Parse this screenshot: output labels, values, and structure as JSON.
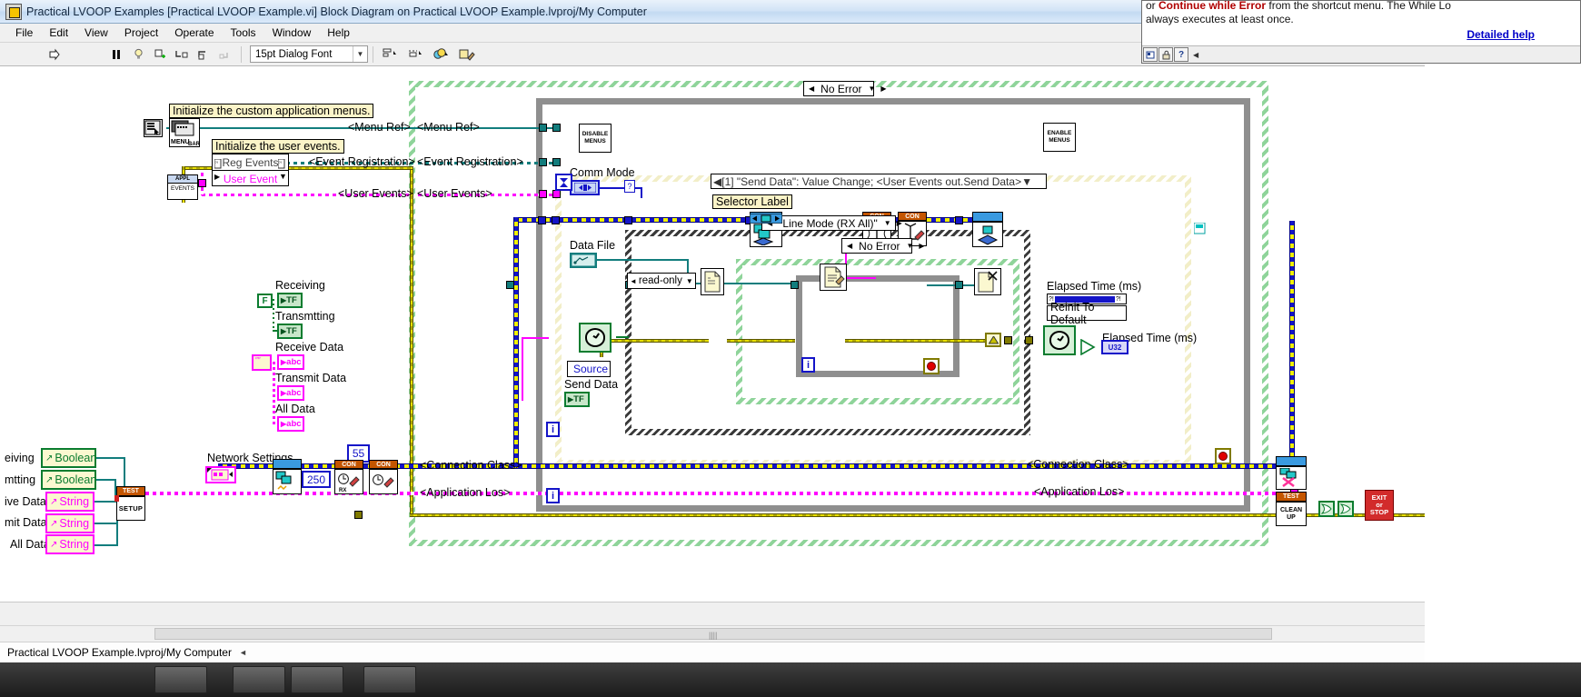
{
  "window": {
    "title": "Practical LVOOP  Examples [Practical LVOOP Example.vi] Block Diagram on Practical LVOOP Example.lvproj/My Computer",
    "app_icon": "labview-icon"
  },
  "menubar": {
    "items": [
      "File",
      "Edit",
      "View",
      "Project",
      "Operate",
      "Tools",
      "Window",
      "Help"
    ]
  },
  "toolbar": {
    "run_arrow": "run-arrow-icon",
    "pause": "pause-icon",
    "highlight": "highlight-execution-icon",
    "retain_values": "retain-wire-values-icon",
    "step_into": "step-into-icon",
    "step_over": "step-over-icon",
    "step_out": "step-out-icon",
    "font_value": "15pt Dialog Font",
    "align_objects": "align-objects-icon",
    "distribute_objects": "distribute-objects-icon",
    "reorder": "reorder-icon",
    "clean_up": "clean-up-diagram-icon"
  },
  "help_window": {
    "line1_pre": "or ",
    "line1_bold": "Continue while Error",
    "line1_post": " from the shortcut menu. The While Lo",
    "line2": "always executes at least once.",
    "detailed_help": "Detailed help",
    "buttons": [
      "show-context-help-icon",
      "lock-help-icon",
      "detailed-help-icon",
      "back-arrow-icon"
    ]
  },
  "statusbar": {
    "project": "Practical LVOOP Example.lvproj/My Computer",
    "arrow": "◄"
  },
  "diagram": {
    "comments": [
      {
        "id": "init-menus",
        "text": "Initialize the custom application menus."
      },
      {
        "id": "init-events",
        "text": "Initialize the user events."
      }
    ],
    "free_labels": [
      {
        "id": "selector-label",
        "text": "Selector Label"
      }
    ],
    "tunnel_labels": [
      {
        "id": "menu-ref-left",
        "text": "<Menu Ref>"
      },
      {
        "id": "menu-ref-right",
        "text": "<Menu Ref>"
      },
      {
        "id": "event-reg-left",
        "text": "<Event Registration>"
      },
      {
        "id": "event-reg-right",
        "text": "<Event Registration>"
      },
      {
        "id": "user-events-left",
        "text": "<User Events>"
      },
      {
        "id": "user-events-right",
        "text": "<User Events>"
      },
      {
        "id": "conn-class-left",
        "text": "<Connection Class>"
      },
      {
        "id": "conn-class-right",
        "text": "<Connection Class>"
      },
      {
        "id": "app-los-left",
        "text": "<Application Los>"
      },
      {
        "id": "app-los-right",
        "text": "<Application Los>"
      }
    ],
    "selectors": [
      {
        "id": "outer-while-error",
        "text": "No Error"
      },
      {
        "id": "line-mode-case",
        "text": "\"Line Mode (RX All)\""
      },
      {
        "id": "inner-error-case",
        "text": "No Error"
      }
    ],
    "event_case": {
      "id": "event-selector",
      "text": "[1] \"Send Data\": Value Change;  <User Events out.Send Data>: User Event"
    },
    "terminal_labels": [
      {
        "id": "receiving",
        "text": "Receiving"
      },
      {
        "id": "transmitting",
        "text": "Transmtting"
      },
      {
        "id": "receive-data",
        "text": "Receive Data"
      },
      {
        "id": "transmit-data",
        "text": "Transmit Data"
      },
      {
        "id": "all-data",
        "text": "All Data"
      },
      {
        "id": "comm-mode",
        "text": "Comm Mode"
      },
      {
        "id": "data-file",
        "text": "Data File"
      },
      {
        "id": "send-data",
        "text": "Send Data"
      },
      {
        "id": "network-settings",
        "text": "Network Settings"
      },
      {
        "id": "elapsed-time-1",
        "text": "Elapsed Time (ms)"
      },
      {
        "id": "elapsed-time-2",
        "text": "Elapsed Time (ms)"
      }
    ],
    "fp_controls": [
      {
        "id": "receiving",
        "label": "eiving",
        "type": "Boolean"
      },
      {
        "id": "transmitting",
        "label": "mtting",
        "type": "Boolean"
      },
      {
        "id": "receive-data",
        "label": "ive Data",
        "type": "String"
      },
      {
        "id": "transmit-data",
        "label": "mit Data",
        "type": "String"
      },
      {
        "id": "all-data",
        "label": "All Data",
        "type": "String"
      }
    ],
    "constants": [
      {
        "id": "false-const",
        "text": "F"
      },
      {
        "id": "timeout-250",
        "text": "250"
      },
      {
        "id": "port-55",
        "text": "55"
      }
    ],
    "sub_vis": [
      {
        "id": "menu-bar-vi",
        "glyph": "MENU BAR"
      },
      {
        "id": "reg-events-vi",
        "glyph": "Reg Events"
      },
      {
        "id": "user-event-sel",
        "glyph": "User Event"
      },
      {
        "id": "appl-events-vi",
        "glyph": "APPL EVENTS"
      },
      {
        "id": "disable-menus-vi",
        "glyph": "DISABLE MENUS"
      },
      {
        "id": "enable-menus-vi",
        "glyph": "ENABLE MENUS"
      },
      {
        "id": "test-setup-vi",
        "header": "TEST",
        "glyph": "SETUP"
      },
      {
        "id": "test-cleanup-vi",
        "header": "TEST",
        "glyph": "CLEAN UP"
      },
      {
        "id": "rx-con-vi",
        "header": "CON",
        "glyph": "RX"
      },
      {
        "id": "con-write-vi",
        "header": "CON",
        "glyph": "write"
      },
      {
        "id": "file-open-vi",
        "glyph": "open-file-icon"
      },
      {
        "id": "file-write-vi",
        "glyph": "write-file-icon"
      },
      {
        "id": "file-close-vi",
        "glyph": "close-file-icon"
      },
      {
        "id": "net-connect-vi",
        "glyph": "network-connect-icon"
      },
      {
        "id": "net-disconnect-vi",
        "glyph": "network-disconnect-icon"
      },
      {
        "id": "net-send-vi",
        "glyph": "network-send-icon"
      }
    ],
    "dropdowns": [
      {
        "id": "file-access-mode",
        "value": "read-only"
      },
      {
        "id": "user-event-ring",
        "value": "User Event"
      }
    ],
    "buttons": [
      {
        "id": "reinit-to-default",
        "text": "Reinit To Default"
      },
      {
        "id": "exit-btn",
        "line1": "EXIT",
        "line2": "or",
        "line3": "STOP"
      }
    ],
    "sources": [
      {
        "id": "source-label",
        "text": "Source"
      }
    ],
    "numeric_reps": [
      {
        "id": "u32-rep",
        "text": "U32"
      }
    ],
    "iterators": [
      {
        "id": "evt-loop-i",
        "text": "i"
      },
      {
        "id": "outer-loop-i",
        "text": "i"
      },
      {
        "id": "inner-loop-i",
        "text": "i"
      }
    ]
  }
}
